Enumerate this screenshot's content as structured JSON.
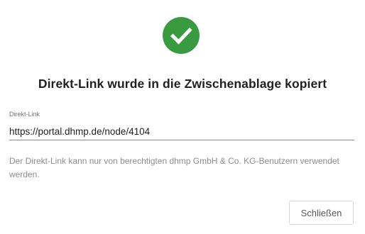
{
  "dialog": {
    "icon": "check-circle-icon",
    "icon_color": "#3a9a40",
    "title": "Direkt-Link wurde in die Zwischenablage kopiert",
    "link_field": {
      "label": "Direkt-Link",
      "value": "https://portal.dhmp.de/node/4104"
    },
    "hint": "Der Direkt-Link kann nur von berechtigten dhmp GmbH & Co. KG-Benutzern verwendet werden.",
    "close_label": "Schließen"
  }
}
